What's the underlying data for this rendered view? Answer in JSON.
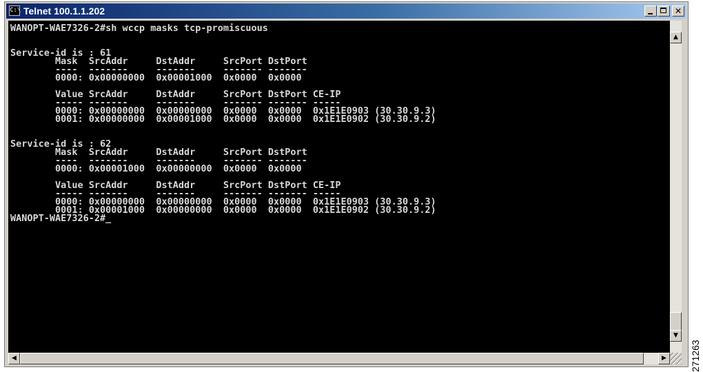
{
  "window": {
    "title": "Telnet 100.1.1.202",
    "icon": "console-icon",
    "minimize_icon": "minimize-icon",
    "maximize_icon": "maximize-icon",
    "close_icon": "close-icon",
    "close_glyph": "✕"
  },
  "terminal": {
    "output": "WANOPT-WAE7326-2#sh wccp masks tcp-promiscuous\n\n\nService-id is : 61\n        Mask  SrcAddr     DstAddr     SrcPort DstPort\n        ----  -------     -------     ------- -------\n        0000: 0x00000000  0x00001000  0x0000  0x0000\n\n        Value SrcAddr     DstAddr     SrcPort DstPort CE-IP\n        ----- -------     -------     ------- ------- -----\n        0000: 0x00000000  0x00000000  0x0000  0x0000  0x1E1E0903 (30.30.9.3)\n        0001: 0x00000000  0x00001000  0x0000  0x0000  0x1E1E0902 (30.30.9.2)\n\n\nService-id is : 62\n        Mask  SrcAddr     DstAddr     SrcPort DstPort\n        ----  -------     -------     ------- -------\n        0000: 0x00001000  0x00000000  0x0000  0x0000\n\n        Value SrcAddr     DstAddr     SrcPort DstPort CE-IP\n        ----- -------     -------     ------- ------- -----\n        0000: 0x00000000  0x00000000  0x0000  0x0000  0x1E1E0903 (30.30.9.3)\n        0001: 0x00001000  0x00000000  0x0000  0x0000  0x1E1E0902 (30.30.9.2)\nWANOPT-WAE7326-2#_"
  },
  "scrollbars": {
    "up_glyph": "▲",
    "down_glyph": "▼",
    "left_glyph": "◀",
    "right_glyph": "▶"
  },
  "figure_id": "271263"
}
